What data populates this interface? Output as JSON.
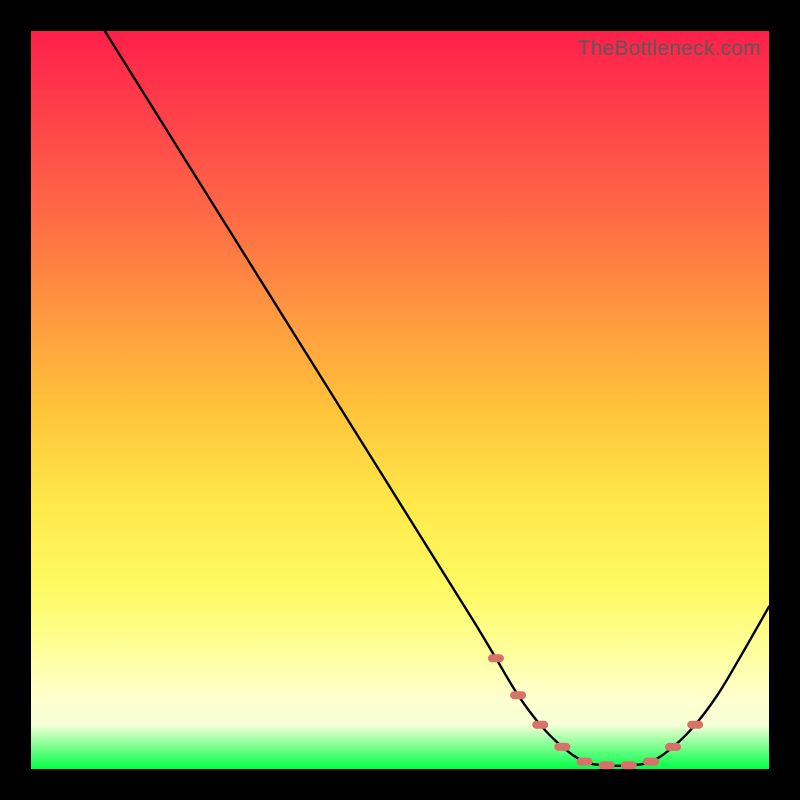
{
  "watermark": "TheBottleneck.com",
  "chart_data": {
    "type": "line",
    "title": "",
    "xlabel": "",
    "ylabel": "",
    "xlim": [
      0,
      100
    ],
    "ylim": [
      0,
      100
    ],
    "series": [
      {
        "name": "bottleneck-curve",
        "color": "#000000",
        "x": [
          10,
          15,
          20,
          25,
          30,
          35,
          40,
          45,
          50,
          55,
          60,
          63,
          66,
          69,
          72,
          75,
          78,
          81,
          84,
          87,
          90,
          93,
          96,
          100
        ],
        "y": [
          100,
          92,
          84,
          76,
          68,
          60,
          52,
          44,
          36,
          28,
          20,
          15,
          10,
          6,
          3,
          1,
          0.5,
          0.5,
          1,
          3,
          6,
          10,
          15,
          22
        ]
      },
      {
        "name": "optimal-range-dots",
        "color": "#d9716b",
        "type": "scatter",
        "x": [
          63,
          66,
          69,
          72,
          75,
          78,
          81,
          84,
          87,
          90
        ],
        "y": [
          15,
          10,
          6,
          3,
          1,
          0.5,
          0.5,
          1,
          3,
          6
        ]
      }
    ]
  }
}
